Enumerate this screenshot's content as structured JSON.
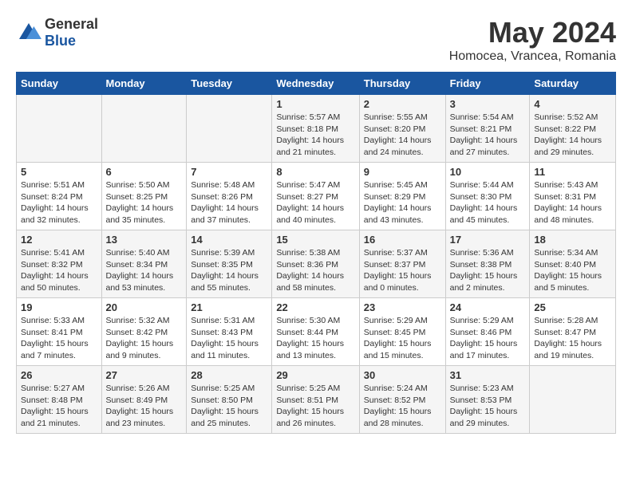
{
  "logo": {
    "general": "General",
    "blue": "Blue"
  },
  "title": "May 2024",
  "subtitle": "Homocea, Vrancea, Romania",
  "weekdays": [
    "Sunday",
    "Monday",
    "Tuesday",
    "Wednesday",
    "Thursday",
    "Friday",
    "Saturday"
  ],
  "weeks": [
    [
      {
        "day": "",
        "info": ""
      },
      {
        "day": "",
        "info": ""
      },
      {
        "day": "",
        "info": ""
      },
      {
        "day": "1",
        "info": "Sunrise: 5:57 AM\nSunset: 8:18 PM\nDaylight: 14 hours\nand 21 minutes."
      },
      {
        "day": "2",
        "info": "Sunrise: 5:55 AM\nSunset: 8:20 PM\nDaylight: 14 hours\nand 24 minutes."
      },
      {
        "day": "3",
        "info": "Sunrise: 5:54 AM\nSunset: 8:21 PM\nDaylight: 14 hours\nand 27 minutes."
      },
      {
        "day": "4",
        "info": "Sunrise: 5:52 AM\nSunset: 8:22 PM\nDaylight: 14 hours\nand 29 minutes."
      }
    ],
    [
      {
        "day": "5",
        "info": "Sunrise: 5:51 AM\nSunset: 8:24 PM\nDaylight: 14 hours\nand 32 minutes."
      },
      {
        "day": "6",
        "info": "Sunrise: 5:50 AM\nSunset: 8:25 PM\nDaylight: 14 hours\nand 35 minutes."
      },
      {
        "day": "7",
        "info": "Sunrise: 5:48 AM\nSunset: 8:26 PM\nDaylight: 14 hours\nand 37 minutes."
      },
      {
        "day": "8",
        "info": "Sunrise: 5:47 AM\nSunset: 8:27 PM\nDaylight: 14 hours\nand 40 minutes."
      },
      {
        "day": "9",
        "info": "Sunrise: 5:45 AM\nSunset: 8:29 PM\nDaylight: 14 hours\nand 43 minutes."
      },
      {
        "day": "10",
        "info": "Sunrise: 5:44 AM\nSunset: 8:30 PM\nDaylight: 14 hours\nand 45 minutes."
      },
      {
        "day": "11",
        "info": "Sunrise: 5:43 AM\nSunset: 8:31 PM\nDaylight: 14 hours\nand 48 minutes."
      }
    ],
    [
      {
        "day": "12",
        "info": "Sunrise: 5:41 AM\nSunset: 8:32 PM\nDaylight: 14 hours\nand 50 minutes."
      },
      {
        "day": "13",
        "info": "Sunrise: 5:40 AM\nSunset: 8:34 PM\nDaylight: 14 hours\nand 53 minutes."
      },
      {
        "day": "14",
        "info": "Sunrise: 5:39 AM\nSunset: 8:35 PM\nDaylight: 14 hours\nand 55 minutes."
      },
      {
        "day": "15",
        "info": "Sunrise: 5:38 AM\nSunset: 8:36 PM\nDaylight: 14 hours\nand 58 minutes."
      },
      {
        "day": "16",
        "info": "Sunrise: 5:37 AM\nSunset: 8:37 PM\nDaylight: 15 hours\nand 0 minutes."
      },
      {
        "day": "17",
        "info": "Sunrise: 5:36 AM\nSunset: 8:38 PM\nDaylight: 15 hours\nand 2 minutes."
      },
      {
        "day": "18",
        "info": "Sunrise: 5:34 AM\nSunset: 8:40 PM\nDaylight: 15 hours\nand 5 minutes."
      }
    ],
    [
      {
        "day": "19",
        "info": "Sunrise: 5:33 AM\nSunset: 8:41 PM\nDaylight: 15 hours\nand 7 minutes."
      },
      {
        "day": "20",
        "info": "Sunrise: 5:32 AM\nSunset: 8:42 PM\nDaylight: 15 hours\nand 9 minutes."
      },
      {
        "day": "21",
        "info": "Sunrise: 5:31 AM\nSunset: 8:43 PM\nDaylight: 15 hours\nand 11 minutes."
      },
      {
        "day": "22",
        "info": "Sunrise: 5:30 AM\nSunset: 8:44 PM\nDaylight: 15 hours\nand 13 minutes."
      },
      {
        "day": "23",
        "info": "Sunrise: 5:29 AM\nSunset: 8:45 PM\nDaylight: 15 hours\nand 15 minutes."
      },
      {
        "day": "24",
        "info": "Sunrise: 5:29 AM\nSunset: 8:46 PM\nDaylight: 15 hours\nand 17 minutes."
      },
      {
        "day": "25",
        "info": "Sunrise: 5:28 AM\nSunset: 8:47 PM\nDaylight: 15 hours\nand 19 minutes."
      }
    ],
    [
      {
        "day": "26",
        "info": "Sunrise: 5:27 AM\nSunset: 8:48 PM\nDaylight: 15 hours\nand 21 minutes."
      },
      {
        "day": "27",
        "info": "Sunrise: 5:26 AM\nSunset: 8:49 PM\nDaylight: 15 hours\nand 23 minutes."
      },
      {
        "day": "28",
        "info": "Sunrise: 5:25 AM\nSunset: 8:50 PM\nDaylight: 15 hours\nand 25 minutes."
      },
      {
        "day": "29",
        "info": "Sunrise: 5:25 AM\nSunset: 8:51 PM\nDaylight: 15 hours\nand 26 minutes."
      },
      {
        "day": "30",
        "info": "Sunrise: 5:24 AM\nSunset: 8:52 PM\nDaylight: 15 hours\nand 28 minutes."
      },
      {
        "day": "31",
        "info": "Sunrise: 5:23 AM\nSunset: 8:53 PM\nDaylight: 15 hours\nand 29 minutes."
      },
      {
        "day": "",
        "info": ""
      }
    ]
  ]
}
